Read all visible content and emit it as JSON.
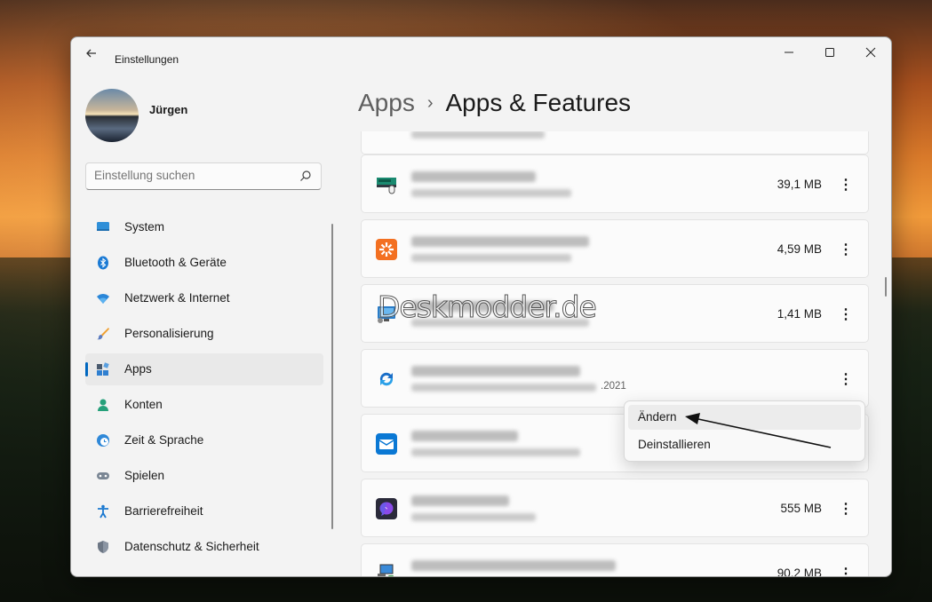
{
  "window": {
    "app_title": "Einstellungen",
    "controls": [
      "minimize",
      "maximize",
      "close"
    ]
  },
  "user": {
    "name": "Jürgen"
  },
  "search": {
    "placeholder": "Einstellung suchen"
  },
  "sidebar": {
    "items": [
      {
        "label": "System",
        "icon": "monitor-icon",
        "selected": false
      },
      {
        "label": "Bluetooth & Geräte",
        "icon": "bluetooth-icon",
        "selected": false
      },
      {
        "label": "Netzwerk & Internet",
        "icon": "wifi-icon",
        "selected": false
      },
      {
        "label": "Personalisierung",
        "icon": "brush-icon",
        "selected": false
      },
      {
        "label": "Apps",
        "icon": "apps-icon",
        "selected": true
      },
      {
        "label": "Konten",
        "icon": "person-icon",
        "selected": false
      },
      {
        "label": "Zeit & Sprache",
        "icon": "clock-globe-icon",
        "selected": false
      },
      {
        "label": "Spielen",
        "icon": "gamepad-icon",
        "selected": false
      },
      {
        "label": "Barrierefreiheit",
        "icon": "accessibility-icon",
        "selected": false
      },
      {
        "label": "Datenschutz & Sicherheit",
        "icon": "shield-icon",
        "selected": false
      }
    ]
  },
  "breadcrumb": {
    "parent": "Apps",
    "separator": "›",
    "current": "Apps & Features"
  },
  "apps": [
    {
      "icon": "network-card-icon",
      "size": "39,1 MB"
    },
    {
      "icon": "orange-app-icon",
      "size": "4,59 MB"
    },
    {
      "icon": "monitor-app-icon",
      "size": "1,41 MB"
    },
    {
      "icon": "sync-arrows-icon",
      "size": "",
      "date": ".2021"
    },
    {
      "icon": "mail-calendar-icon",
      "size": ""
    },
    {
      "icon": "messenger-icon",
      "size": "555 MB"
    },
    {
      "icon": "installer-icon",
      "size": "90,2 MB"
    }
  ],
  "context_menu": {
    "items": [
      "Ändern",
      "Deinstallieren"
    ]
  },
  "watermark": "Deskmodder.de",
  "colors": {
    "accent": "#0067c0",
    "window_bg": "#f3f3f3",
    "card_bg": "#fbfbfb"
  }
}
